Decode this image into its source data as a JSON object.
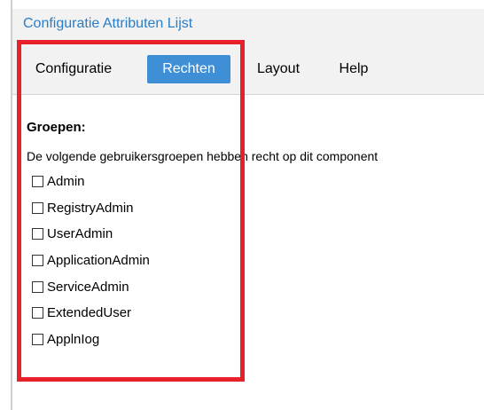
{
  "window": {
    "title": "Configuratie Attributen Lijst"
  },
  "menu": {
    "tabs": [
      {
        "label": "Configuratie",
        "active": false
      },
      {
        "label": "Rechten",
        "active": true
      },
      {
        "label": "Layout",
        "active": false
      },
      {
        "label": "Help",
        "active": false
      }
    ]
  },
  "rights": {
    "heading": "Groepen:",
    "description": "De volgende gebruikersgroepen hebben recht op dit component",
    "groups": [
      {
        "label": "Admin",
        "checked": false
      },
      {
        "label": "RegistryAdmin",
        "checked": false
      },
      {
        "label": "UserAdmin",
        "checked": false
      },
      {
        "label": "ApplicationAdmin",
        "checked": false
      },
      {
        "label": "ServiceAdmin",
        "checked": false
      },
      {
        "label": "ExtendedUser",
        "checked": false
      },
      {
        "label": "ApplnIog",
        "checked": false
      }
    ]
  },
  "colors": {
    "title_text": "#2a7dc8",
    "active_tab_bg": "#3e8fd6",
    "highlight_border": "#e8202a",
    "bar_bg": "#f2f2f2"
  }
}
